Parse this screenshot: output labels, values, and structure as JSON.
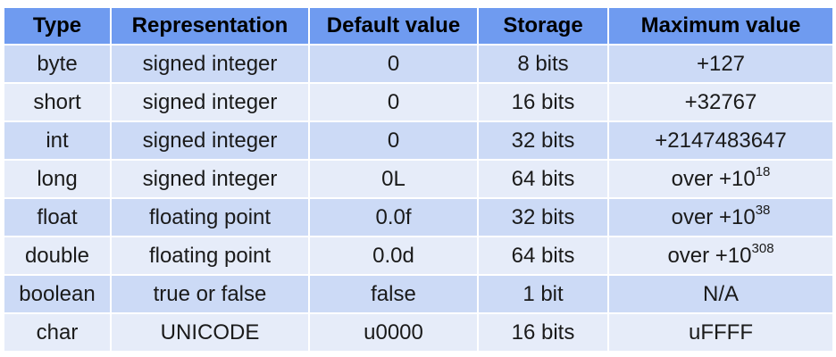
{
  "table": {
    "headers": [
      "Type",
      "Representation",
      "Default value",
      "Storage",
      "Maximum value"
    ],
    "rows": [
      {
        "type": "byte",
        "representation": "signed integer",
        "default": "0",
        "storage": "8 bits",
        "max_base": "+127",
        "max_exp": ""
      },
      {
        "type": "short",
        "representation": "signed integer",
        "default": "0",
        "storage": "16 bits",
        "max_base": "+32767",
        "max_exp": ""
      },
      {
        "type": "int",
        "representation": "signed integer",
        "default": "0",
        "storage": "32 bits",
        "max_base": "+2147483647",
        "max_exp": ""
      },
      {
        "type": "long",
        "representation": "signed integer",
        "default": "0L",
        "storage": "64 bits",
        "max_base": "over +10",
        "max_exp": "18"
      },
      {
        "type": "float",
        "representation": "floating point",
        "default": "0.0f",
        "storage": "32 bits",
        "max_base": "over +10",
        "max_exp": "38"
      },
      {
        "type": "double",
        "representation": "floating point",
        "default": "0.0d",
        "storage": "64 bits",
        "max_base": "over +10",
        "max_exp": "308"
      },
      {
        "type": "boolean",
        "representation": "true or false",
        "default": "false",
        "storage": "1 bit",
        "max_base": "N/A",
        "max_exp": ""
      },
      {
        "type": "char",
        "representation": "UNICODE",
        "default": "u0000",
        "storage": "16 bits",
        "max_base": "uFFFF",
        "max_exp": ""
      }
    ]
  },
  "colors": {
    "header_bg": "#6f9bf0",
    "row_odd_bg": "#ccdaf6",
    "row_even_bg": "#e6ecf9"
  }
}
